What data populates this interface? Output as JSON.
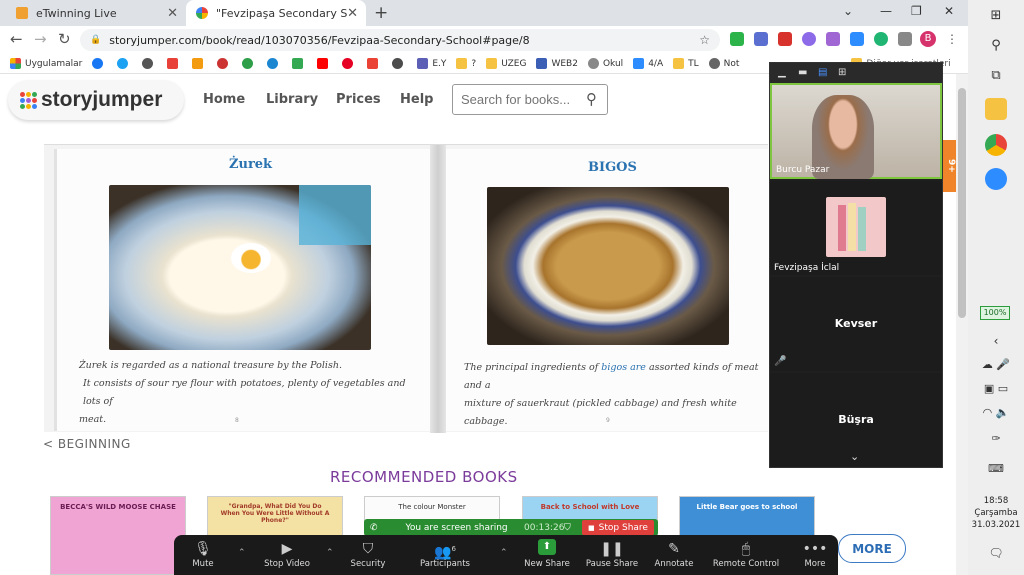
{
  "tabs": [
    {
      "title": "eTwinning Live",
      "favicon": "etwinning-icon"
    },
    {
      "title": "\"Fevzipaşa Secondary School\" - ",
      "favicon": "storyjumper-icon"
    }
  ],
  "address": {
    "url": "storyjumper.com/book/read/103070356/Fevzipaa-Secondary-School#page/8"
  },
  "profile_initial": "B",
  "bookmarks": [
    "Uygulamalar",
    "E.Y",
    "?",
    "UZEG",
    "WEB2",
    "Okul",
    "4/A",
    "TL",
    "Not",
    "Diğer yer işaretleri"
  ],
  "site": {
    "logo": "storyjumper",
    "menu": [
      "Home",
      "Library",
      "Prices",
      "Help"
    ],
    "search_placeholder": "Search for books...",
    "beginning": "< BEGINNING",
    "recommended": "RECOMMENDED BOOKS",
    "more": "MORE",
    "side_tab": "9+"
  },
  "book": {
    "left": {
      "title": "Żurek",
      "line1": "Żurek is regarded as a national treasure by the Polish.",
      "line2": "It consists of sour rye flour with potatoes, plenty of vegetables and lots of",
      "line3": "meat.",
      "page_number": "8"
    },
    "right": {
      "title": "BIGOS",
      "text_a": "The principal ingredients of ",
      "text_link": "bigos",
      "text_b": " are",
      "text_c": " assorted kinds of meat and a",
      "line2": "mixture of sauerkraut (pickled cabbage) and fresh white cabbage.",
      "page_number": "9"
    }
  },
  "thumbnails": [
    {
      "title": "BECCA'S WILD MOOSE CHASE"
    },
    {
      "title": "\"Grandpa, What Did You Do When You Were Little Without A Phone?\""
    },
    {
      "title": "The colour Monster"
    },
    {
      "title": "Back to School with Love"
    },
    {
      "title": "Little Bear goes to school"
    }
  ],
  "zoom": {
    "participants": [
      {
        "name": "Burcu Pazar",
        "kind": "video"
      },
      {
        "name": "Fevzipaşa İclal",
        "kind": "avatar"
      },
      {
        "name": "Kevser",
        "kind": "name"
      },
      {
        "name": "Büşra",
        "kind": "name"
      }
    ],
    "share_status": "You are screen sharing",
    "share_time": "00:13:26",
    "stop_share": "Stop Share",
    "participant_count": "6",
    "toolbar": [
      "Mute",
      "Stop Video",
      "Security",
      "Participants",
      "New Share",
      "Pause Share",
      "Annotate",
      "Remote Control",
      "More"
    ]
  },
  "taskbar": {
    "battery": "100%",
    "time": "18:58",
    "day": "Çarşamba",
    "date": "31.03.2021"
  },
  "colors": {
    "accent": "#2a72b0",
    "recommended": "#7b3b9b",
    "zoom_green": "#2a8c30",
    "stop_red": "#e0403c"
  }
}
